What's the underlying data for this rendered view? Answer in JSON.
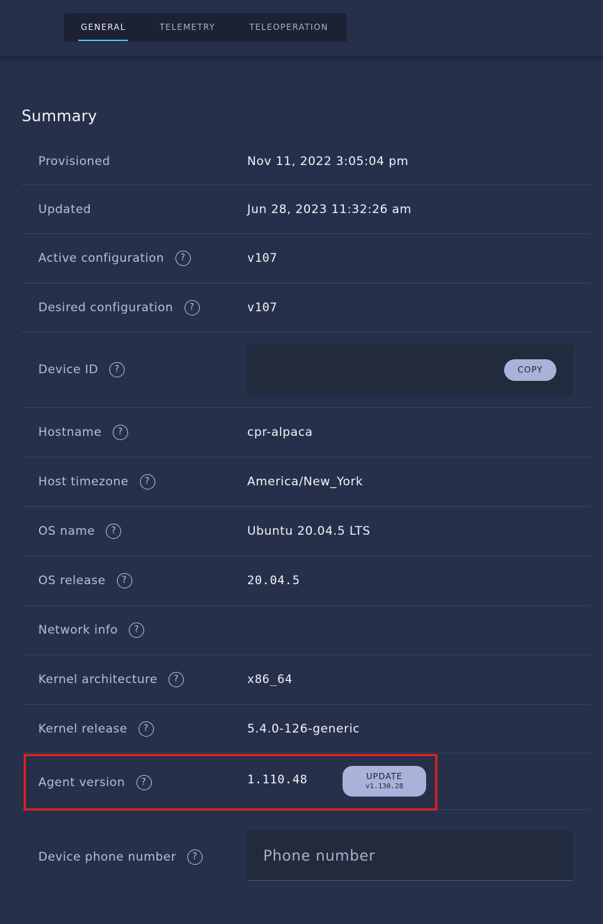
{
  "tabs": [
    {
      "label": "GENERAL",
      "active": true
    },
    {
      "label": "TELEMETRY",
      "active": false
    },
    {
      "label": "TELEOPERATION",
      "active": false
    }
  ],
  "summary": {
    "title": "Summary",
    "help_glyph": "?",
    "rows": {
      "provisioned": {
        "label": "Provisioned",
        "value": "Nov 11, 2022 3:05:04 pm"
      },
      "updated": {
        "label": "Updated",
        "value": "Jun 28, 2023 11:32:26 am"
      },
      "active_configuration": {
        "label": "Active configuration",
        "value": "v107"
      },
      "desired_configuration": {
        "label": "Desired configuration",
        "value": "v107"
      },
      "device_id": {
        "label": "Device ID",
        "copy_label": "COPY"
      },
      "hostname": {
        "label": "Hostname",
        "value": "cpr-alpaca"
      },
      "host_timezone": {
        "label": "Host timezone",
        "value": "America/New_York"
      },
      "os_name": {
        "label": "OS name",
        "value": "Ubuntu 20.04.5 LTS"
      },
      "os_release": {
        "label": "OS release",
        "value": "20.04.5"
      },
      "network_info": {
        "label": "Network info"
      },
      "kernel_architecture": {
        "label": "Kernel architecture",
        "value": "x86_64"
      },
      "kernel_release": {
        "label": "Kernel release",
        "value": "5.4.0-126-generic"
      },
      "agent_version": {
        "label": "Agent version",
        "value": "1.110.48",
        "update_label": "UPDATE",
        "update_version": "v1.130.28"
      },
      "device_phone_number": {
        "label": "Device phone number",
        "placeholder": "Phone number",
        "value": ""
      }
    }
  },
  "colors": {
    "background": "#27304a",
    "tab_bar": "#1c2233",
    "tab_active_underline": "#4fc3f7",
    "button": "#a9b3d9",
    "highlight": "#e3221b"
  },
  "icons": [
    "question-circle-icon"
  ]
}
